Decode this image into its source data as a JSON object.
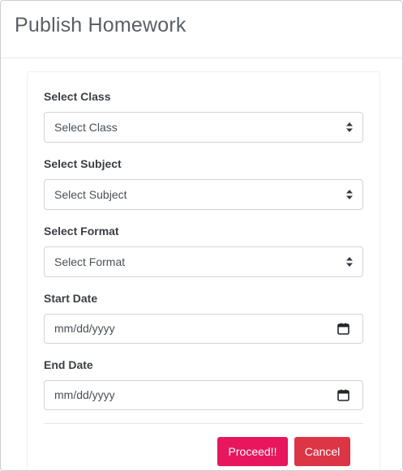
{
  "modal": {
    "title": "Publish Homework"
  },
  "form": {
    "class": {
      "label": "Select Class",
      "selected": "Select Class"
    },
    "subject": {
      "label": "Select Subject",
      "selected": "Select Subject"
    },
    "format": {
      "label": "Select Format",
      "selected": "Select Format"
    },
    "start_date": {
      "label": "Start Date",
      "placeholder": "mm/dd/yyyy"
    },
    "end_date": {
      "label": "End Date",
      "placeholder": "mm/dd/yyyy"
    }
  },
  "actions": {
    "proceed_label": "Proceed!!",
    "cancel_label": "Cancel"
  },
  "colors": {
    "proceed": "#e8175d",
    "cancel": "#dc3545",
    "title": "#5a5f66"
  },
  "icons": {
    "select_arrows": "sort-arrows-icon",
    "date": "calendar-icon"
  }
}
